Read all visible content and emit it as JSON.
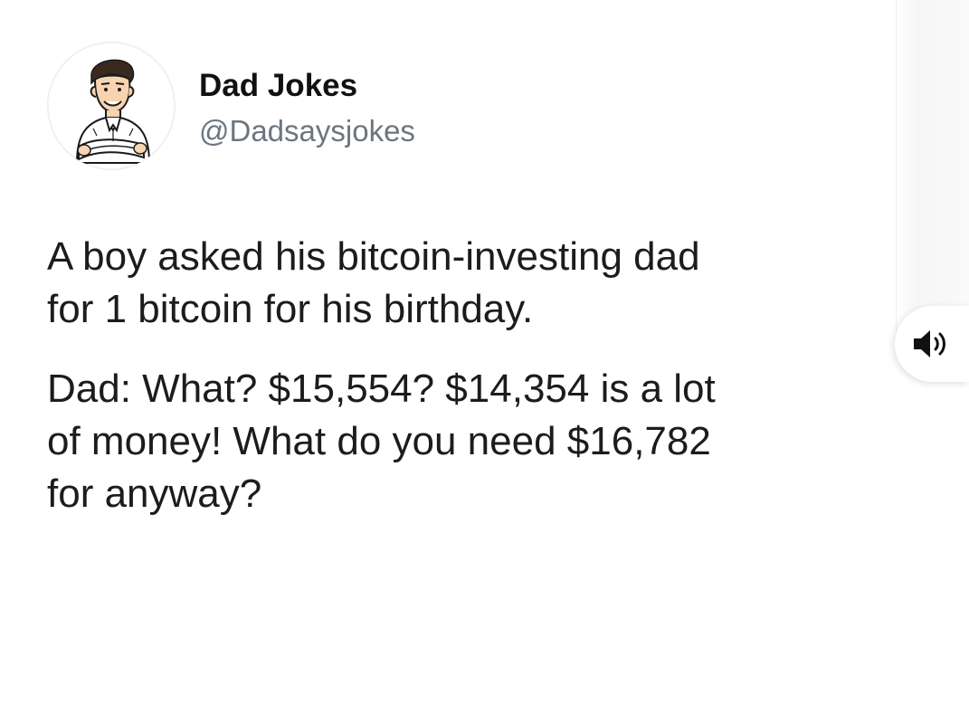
{
  "profile": {
    "display_name": "Dad Jokes",
    "handle": "@Dadsaysjokes",
    "avatar_icon": "cartoon-man-arms-crossed-avatar"
  },
  "tweet": {
    "paragraphs": [
      {
        "lines": [
          "A boy asked his bitcoin-investing dad",
          "for 1 bitcoin for his birthday."
        ]
      },
      {
        "lines": [
          "Dad: What? $15,554? $14,354 is a lot",
          "of money! What do you need $16,782",
          "for anyway?"
        ]
      }
    ]
  },
  "controls": {
    "sound_icon": "speaker-volume-icon"
  }
}
